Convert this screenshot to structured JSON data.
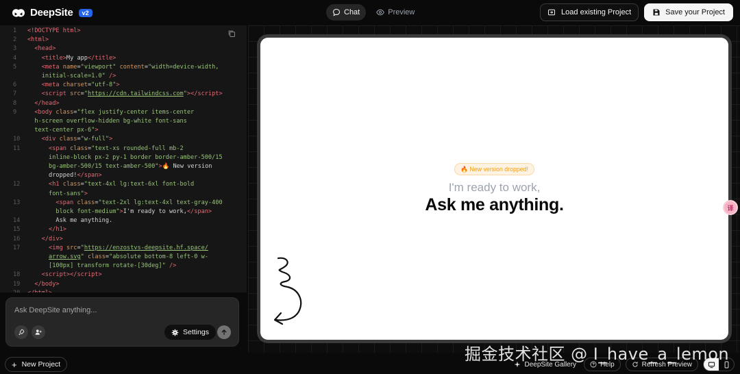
{
  "header": {
    "app_name": "DeepSite",
    "badge": "v2",
    "tabs": [
      {
        "label": "Chat",
        "icon": "chat-bubble-icon",
        "active": true
      },
      {
        "label": "Preview",
        "icon": "eye-icon",
        "active": false
      }
    ],
    "load_button": "Load existing Project",
    "save_button": "Save your Project"
  },
  "editor": {
    "lines": [
      {
        "n": "1",
        "html": "<span class=\"tag\">&lt;!DOCTYPE html&gt;</span>"
      },
      {
        "n": "2",
        "html": "<span class=\"tag\">&lt;html&gt;</span>"
      },
      {
        "n": "3",
        "html": "  <span class=\"tag\">&lt;head&gt;</span>"
      },
      {
        "n": "4",
        "html": "    <span class=\"tag\">&lt;title&gt;</span>My app<span class=\"tag\">&lt;/title&gt;</span>"
      },
      {
        "n": "5",
        "html": "    <span class=\"tag\">&lt;meta</span> <span class=\"attr\">name</span>=<span class=\"str\">\"viewport\"</span> <span class=\"attr\">content</span>=<span class=\"str\">\"width=device-width,</span>"
      },
      {
        "n": "",
        "html": "    <span class=\"str\">initial-scale=1.0\"</span> <span class=\"tag\">/&gt;</span>"
      },
      {
        "n": "6",
        "html": "    <span class=\"tag\">&lt;meta</span> <span class=\"attr\">charset</span>=<span class=\"str\">\"utf-8\"</span><span class=\"tag\">&gt;</span>"
      },
      {
        "n": "7",
        "html": "    <span class=\"tag\">&lt;script</span> <span class=\"attr\">src</span>=<span class=\"str\">\"</span><span class=\"url\">https://cdn.tailwindcss.com</span><span class=\"str\">\"</span><span class=\"tag\">&gt;&lt;/script&gt;</span>"
      },
      {
        "n": "8",
        "html": "  <span class=\"tag\">&lt;/head&gt;</span>"
      },
      {
        "n": "9",
        "html": "  <span class=\"tag\">&lt;body</span> <span class=\"attr\">class</span>=<span class=\"str\">\"flex justify-center items-center</span>"
      },
      {
        "n": "",
        "html": "  <span class=\"str\">h-screen overflow-hidden bg-white font-sans</span>"
      },
      {
        "n": "",
        "html": "  <span class=\"str\">text-center px-6\"</span><span class=\"tag\">&gt;</span>"
      },
      {
        "n": "10",
        "html": "    <span class=\"tag\">&lt;div</span> <span class=\"attr\">class</span>=<span class=\"str\">\"w-full\"</span><span class=\"tag\">&gt;</span>"
      },
      {
        "n": "11",
        "html": "      <span class=\"tag\">&lt;span</span> <span class=\"attr\">class</span>=<span class=\"str\">\"text-xs rounded-full mb-2</span>"
      },
      {
        "n": "",
        "html": "      <span class=\"str\">inline-block px-2 py-1 border border-amber-500/15</span>"
      },
      {
        "n": "",
        "html": "      <span class=\"str\">bg-amber-500/15 text-amber-500\"</span><span class=\"tag\">&gt;</span>🔥 New version"
      },
      {
        "n": "",
        "html": "      dropped!<span class=\"tag\">&lt;/span&gt;</span>"
      },
      {
        "n": "12",
        "html": "      <span class=\"tag\">&lt;h1</span> <span class=\"attr\">class</span>=<span class=\"str\">\"text-4xl lg:text-6xl font-bold</span>"
      },
      {
        "n": "",
        "html": "      <span class=\"str\">font-sans\"</span><span class=\"tag\">&gt;</span>"
      },
      {
        "n": "13",
        "html": "        <span class=\"tag\">&lt;span</span> <span class=\"attr\">class</span>=<span class=\"str\">\"text-2xl lg:text-4xl text-gray-400</span>"
      },
      {
        "n": "",
        "html": "        <span class=\"str\">block font-medium\"</span><span class=\"tag\">&gt;</span>I'm ready to work,<span class=\"tag\">&lt;/span&gt;</span>"
      },
      {
        "n": "14",
        "html": "        Ask me anything."
      },
      {
        "n": "15",
        "html": "      <span class=\"tag\">&lt;/h1&gt;</span>"
      },
      {
        "n": "16",
        "html": "    <span class=\"tag\">&lt;/div&gt;</span>"
      },
      {
        "n": "17",
        "html": "      <span class=\"tag\">&lt;img</span> <span class=\"attr\">src</span>=<span class=\"str\">\"</span><span class=\"url\">https://enzostvs-deepsite.hf.space/</span>"
      },
      {
        "n": "",
        "html": "      <span class=\"url\">arrow.svg</span><span class=\"str\">\"</span> <span class=\"attr\">class</span>=<span class=\"str\">\"absolute bottom-8 left-0 w-</span>"
      },
      {
        "n": "",
        "html": "      <span class=\"str\">[100px] transform rotate-[30deg]\"</span> <span class=\"tag\">/&gt;</span>"
      },
      {
        "n": "18",
        "html": "    <span class=\"tag\">&lt;script&gt;&lt;/script&gt;</span>"
      },
      {
        "n": "19",
        "html": "  <span class=\"tag\">&lt;/body&gt;</span>"
      },
      {
        "n": "20",
        "html": "<span class=\"tag\">&lt;/html&gt;</span>"
      }
    ]
  },
  "chat": {
    "placeholder": "Ask DeepSite anything...",
    "settings_label": "Settings"
  },
  "preview": {
    "badge": "🔥 New version dropped!",
    "subtitle": "I'm ready to work,",
    "title": "Ask me anything."
  },
  "footer": {
    "new_project": "New  Project",
    "gallery": "DeepSite Gallery",
    "help": "Help",
    "refresh": "Refresh Preview"
  },
  "watermark": "掘金技术社区 @ I_have_a_lemon",
  "colors": {
    "accent_blue": "#2563eb",
    "amber": "#f59e0b",
    "editor_bg": "#161616"
  }
}
